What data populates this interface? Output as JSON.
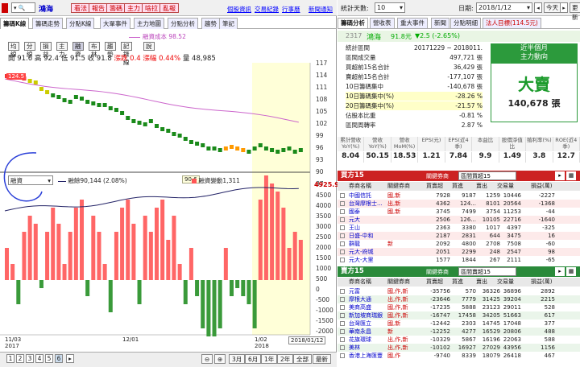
{
  "left": {
    "stock_name": "鴻海",
    "buttons": [
      "看法",
      "報告",
      "籌碼",
      "主力",
      "啥拉",
      "亂報"
    ],
    "links": [
      "個股資訊",
      "交易紀錄",
      "行事曆",
      "新聞通知"
    ],
    "tabs": [
      "籌碼K線",
      "籌碼走勢",
      "分點K線",
      "大單事件",
      "主力地圖",
      "分點分析",
      "趨勢",
      "筆記"
    ],
    "legend_label": "融資成本 98.52",
    "tools": [
      "均線",
      "分線",
      "損益",
      "主力",
      "融資",
      "布林",
      "趨勢",
      "記錄線",
      "說"
    ],
    "quote": {
      "open_label": "開",
      "open": "91.6",
      "high_label": "高",
      "high": "92.4",
      "low_label": "低",
      "low": "91.5",
      "close_label": "收",
      "close": "91.8",
      "chg_label": "漲跌",
      "chg": "0.4",
      "pct_label": "漲幅",
      "pct": "0.44%",
      "vol_label": "量",
      "vol": "48,985"
    },
    "price_badge": "124.5",
    "price_axis": [
      "117",
      "114",
      "111",
      "108",
      "105",
      "102",
      "99",
      "96",
      "93",
      "90",
      "87"
    ],
    "low_badge": "90.6",
    "sub_select": "融資",
    "sub_legend1": "融餘90,144 (2.08%)",
    "sub_legend2": "融資變動1,311",
    "sub_top_value": "4925.9",
    "sub_axis": [
      "4500",
      "4000",
      "3500",
      "3000",
      "2500",
      "2000",
      "1500",
      "1000",
      "500",
      "0",
      "-500",
      "-1000",
      "-1500",
      "-2000"
    ],
    "date_labels": [
      "11/03",
      "2017",
      "12/01",
      "1/02",
      "2018"
    ],
    "date_badge": "2018/01/12",
    "pages": [
      "1",
      "2",
      "3",
      "4",
      "5",
      "6"
    ],
    "ranges": [
      "3月",
      "6月",
      "1年",
      "2年",
      "全部",
      "最新"
    ]
  },
  "right": {
    "range_label": "統計天數:",
    "range_value": "10",
    "date_label": "日期:",
    "date_value": "2018/1/12",
    "nav": [
      "今天",
      "更新"
    ],
    "tabs": [
      "籌碼分析",
      "營收表",
      "重大事件",
      "新聞",
      "分點明細",
      "法人目標(114.5元)"
    ],
    "code": "2317",
    "name": "鴻海",
    "price": "91.8元",
    "change": "▼2.5 (-2.65%)",
    "stats": [
      {
        "k": "統計區間",
        "v": "20171229 ~ 2018011."
      },
      {
        "k": "區間成交量",
        "v": "497,721 張"
      },
      {
        "k": "買超前15名合計",
        "v": "36,429 張"
      },
      {
        "k": "賣超前15名合計",
        "v": "-177,107 張"
      },
      {
        "k": "10日籌碼集中",
        "v": "-140,678 張"
      },
      {
        "k": "10日籌碼集中(%)",
        "v": "-28.26 %"
      },
      {
        "k": "20日籌碼集中(%)",
        "v": "-21.57 %"
      },
      {
        "k": "佔股本比重",
        "v": "-0.81 %"
      },
      {
        "k": "區間周轉率",
        "v": "2.87 %"
      }
    ],
    "box_title": "近半個月",
    "box_sub": "主力動向",
    "box_main": "大賣",
    "box_qty": "140,678 張",
    "fin_headers": [
      "累計營收YoY(%)",
      "營收YoY(%)",
      "營收MoM(%)",
      "EPS(元)",
      "EPS(近4季)",
      "本益比",
      "股價淨值比",
      "殖利率(%)",
      "ROE(近4季)"
    ],
    "fin_values": [
      "8.04",
      "50.15",
      "18.53",
      "1.21",
      "7.84",
      "9.9",
      "1.49",
      "3.8",
      "12.7"
    ],
    "buy_title": "買方15",
    "buy_select": "關鍵券商",
    "buy_select_value": "區間買超15",
    "buy_cols": [
      "券商名稱",
      "關鍵券商",
      "買賣超",
      "買進",
      "賣出",
      "交易量",
      "損益(萬)"
    ],
    "buy_rows": [
      [
        "中國信託",
        "國,新",
        "7928",
        "9187",
        "1259",
        "10446",
        "-2227"
      ],
      [
        "台灣摩根士...",
        "出,新",
        "4362",
        "124...",
        "8101",
        "20564",
        "-1368"
      ],
      [
        "國泰",
        "國,新",
        "3745",
        "7499",
        "3754",
        "11253",
        "-44"
      ],
      [
        "元大",
        "",
        "2506",
        "126...",
        "10105",
        "22716",
        "-1640"
      ],
      [
        "王山",
        "",
        "2363",
        "3380",
        "1017",
        "4397",
        "-325"
      ],
      [
        "日盛-中和",
        "",
        "2187",
        "2831",
        "644",
        "3475",
        "16"
      ],
      [
        "群龍",
        "新",
        "2092",
        "4800",
        "2708",
        "7508",
        "-60"
      ],
      [
        "元大-府城",
        "",
        "2051",
        "2299",
        "248",
        "2547",
        "98"
      ],
      [
        "元大-大里",
        "",
        "1577",
        "1844",
        "267",
        "2111",
        "-65"
      ]
    ],
    "sell_title": "賣方15",
    "sell_select": "關鍵券商",
    "sell_select_value": "區間賣超15",
    "sell_cols": [
      "券商名稱",
      "關鍵券商",
      "買賣超",
      "買進",
      "賣出",
      "交易量",
      "損益(萬)"
    ],
    "sell_rows": [
      [
        "元富",
        "國,作,新",
        "-35756",
        "570",
        "36326",
        "36896",
        "2892"
      ],
      [
        "摩根大通",
        "出,作,新",
        "-23646",
        "7779",
        "31425",
        "39204",
        "2215"
      ],
      [
        "美商高盛",
        "國,作,新",
        "-17235",
        "5888",
        "23123",
        "29011",
        "528"
      ],
      [
        "新加坡商瑞銀",
        "國,作,新",
        "-16747",
        "17458",
        "34205",
        "51663",
        "617"
      ],
      [
        "台灣匯立",
        "國,新",
        "-12442",
        "2303",
        "14745",
        "17048",
        "377"
      ],
      [
        "華南永昌",
        "新",
        "-12252",
        "4277",
        "16529",
        "20806",
        "488"
      ],
      [
        "花旗環球",
        "出,作,新",
        "-10329",
        "5867",
        "16196",
        "22063",
        "588"
      ],
      [
        "美林",
        "出,作,新",
        "-10102",
        "16927",
        "27029",
        "43956",
        "1156"
      ],
      [
        "香港上海匯豐",
        "國,作",
        "-9740",
        "8339",
        "18079",
        "26418",
        "467"
      ]
    ]
  }
}
